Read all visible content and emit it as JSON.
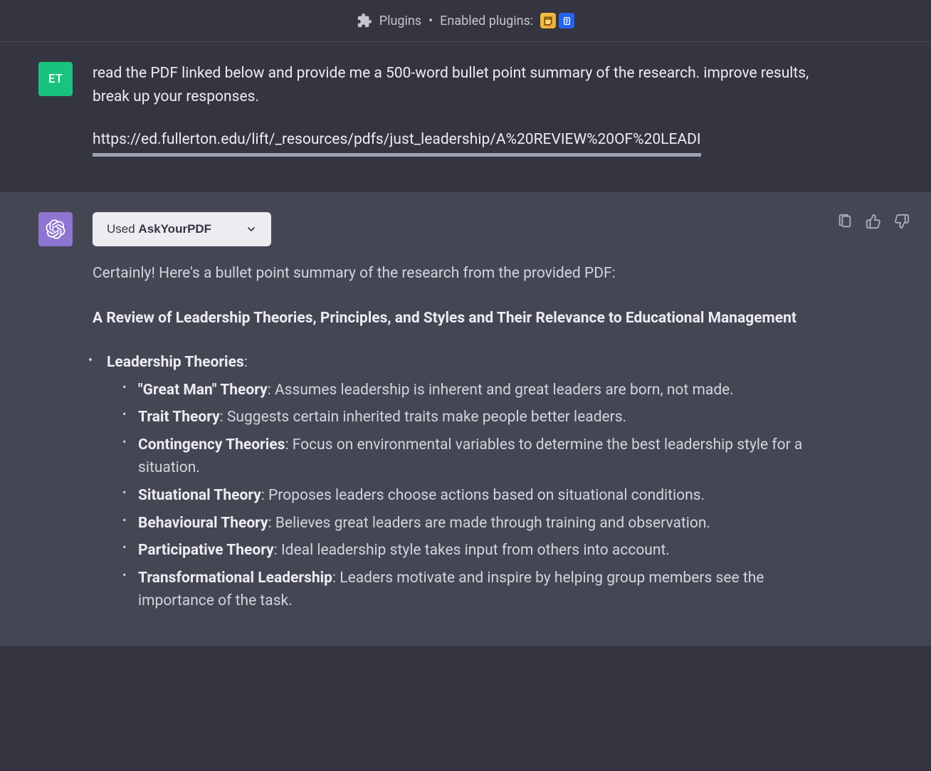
{
  "header": {
    "plugins_label": "Plugins",
    "separator": "•",
    "enabled_label": "Enabled plugins:",
    "plugin_icons": [
      "note-icon",
      "document-icon"
    ]
  },
  "user": {
    "avatar_initials": "ET",
    "message_text": "read the PDF linked below and provide me a 500-word bullet point summary of the research. improve results, break up your responses.",
    "url": "https://ed.fullerton.edu/lift/_resources/pdfs/just_leadership/A%20REVIEW%20OF%20LEADI"
  },
  "assistant": {
    "plugin_used_prefix": "Used ",
    "plugin_used_name": "AskYourPDF",
    "intro": "Certainly! Here's a bullet point summary of the research from the provided PDF:",
    "heading": "A Review of Leadership Theories, Principles, and Styles and Their Relevance to Educational Management",
    "section_title": "Leadership Theories",
    "section_colon": ":",
    "bullets": [
      {
        "term": "\"Great Man\" Theory",
        "desc": ": Assumes leadership is inherent and great leaders are born, not made."
      },
      {
        "term": "Trait Theory",
        "desc": ": Suggests certain inherited traits make people better leaders."
      },
      {
        "term": "Contingency Theories",
        "desc": ": Focus on environmental variables to determine the best leadership style for a situation."
      },
      {
        "term": "Situational Theory",
        "desc": ": Proposes leaders choose actions based on situational conditions."
      },
      {
        "term": "Behavioural Theory",
        "desc": ": Believes great leaders are made through training and observation."
      },
      {
        "term": "Participative Theory",
        "desc": ": Ideal leadership style takes input from others into account."
      },
      {
        "term": "Transformational Leadership",
        "desc": ": Leaders motivate and inspire by helping group members see the importance of the task."
      }
    ]
  }
}
